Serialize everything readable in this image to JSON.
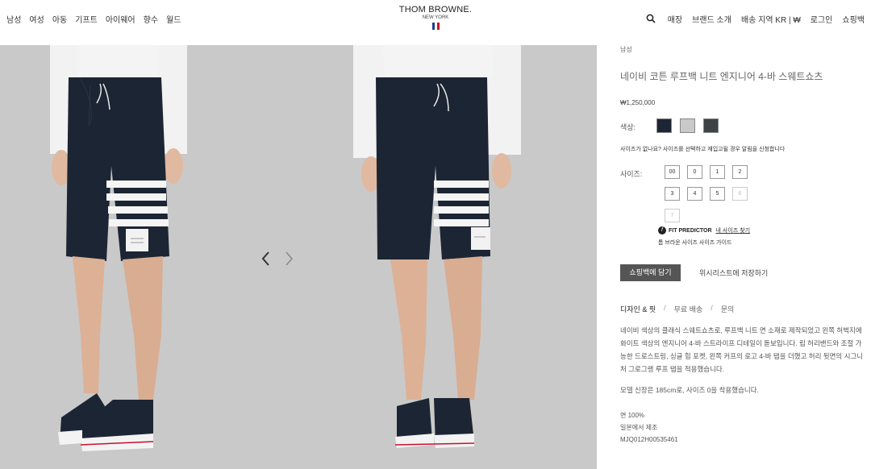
{
  "header": {
    "nav_left": [
      "남성",
      "여성",
      "아동",
      "기프트",
      "아이웨어",
      "향수",
      "월드"
    ],
    "logo": {
      "name": "THOM BROWNE.",
      "sub": "NEW YORK"
    },
    "nav_right": [
      "매장",
      "브랜드 소개",
      "배송 지역 KR | ₩",
      "로그인",
      "쇼핑백"
    ],
    "search_icon": "search-icon"
  },
  "gallery": {
    "prev_icon": "chevron-left-icon",
    "next_icon": "chevron-right-icon"
  },
  "product": {
    "breadcrumb": "남성",
    "title": "네이비 코튼 루프백 니트 엔지니어 4-바 스웨트쇼츠",
    "price": "₩1,250,000",
    "color_label": "색상:",
    "colors": [
      "#1c2533",
      "#c9c9c9",
      "#3f4245"
    ],
    "size_note": "사이즈가 없나요? 사이즈를 선택하고 재입고될 경우 알림을 신청합니다",
    "size_label": "사이즈:",
    "sizes": [
      "00",
      "0",
      "1",
      "2",
      "3",
      "4",
      "5",
      "6",
      "7"
    ],
    "fit_predictor": {
      "brand": "FIT PREDICTOR",
      "link": "내 사이즈 찾기"
    },
    "size_guide": "톰 브라운 사이즈 사이즈 가이드",
    "add_to_bag": "쇼핑백에 담기",
    "wishlist": "위시리스트에 저장하기",
    "tabs": [
      "디자인 & 핏",
      "무료 배송",
      "문의"
    ],
    "description": "네이비 색상의 클래식 스웨트쇼츠로, 루프백 니트 면 소재로 제작되었고 왼쪽 허벅지에 화이트 색상의 엔지니어 4-바 스트라이프 디테일이 돋보입니다. 립 허리밴드와 조절 가능한 드로스트링, 싱글 힙 포켓, 왼쪽 커프의 로고 4-바 탭을 더했고 허리 뒷면의 시그니처 그로그랭 루프 탭을 적용했습니다.",
    "model_note": "모델 신장은 185cm로, 사이즈 0을 착용했습니다.",
    "material": "면 100%",
    "origin": "일본에서 제조",
    "sku": "MJQ012H00535461"
  }
}
